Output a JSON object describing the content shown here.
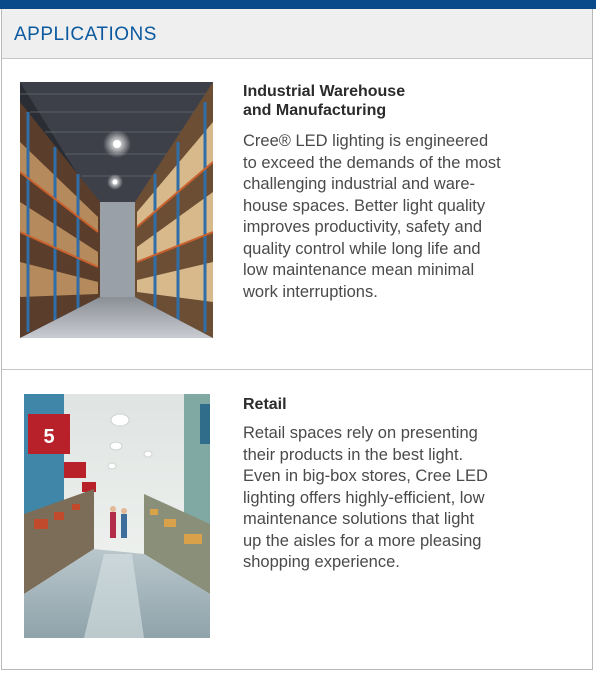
{
  "header": {
    "title": "APPLICATIONS"
  },
  "applications": [
    {
      "title_line1": "Industrial Warehouse",
      "title_line2": "and Manufacturing",
      "body": "Cree® LED lighting is engineered\nto exceed the demands of the most\nchallenging industrial and ware-\nhouse spaces. Better light quality\nimproves productivity, safety and\nquality control while long life and\nlow maintenance mean minimal\nwork interruptions.",
      "image_icon": "warehouse-photo"
    },
    {
      "title": "Retail",
      "body": "Retail spaces rely on presenting\ntheir products in the best light.\nEven in big-box stores, Cree LED\nlighting offers highly-efficient, low\nmaintenance solutions that light\nup the aisles for a more pleasing\nshopping experience.",
      "image_icon": "retail-store-photo",
      "aisle_sign": "5"
    }
  ],
  "colors": {
    "accent": "#0b4a8a",
    "header_text": "#0b5aa0",
    "header_bg": "#efefef"
  }
}
